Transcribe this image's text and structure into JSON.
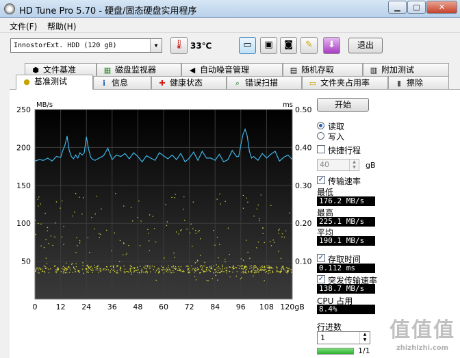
{
  "window": {
    "title": "HD Tune Pro 5.70 - 硬盘/固态硬盘实用程序"
  },
  "menu": [
    {
      "label": "文件(F)"
    },
    {
      "label": "帮助(H)"
    }
  ],
  "toolbar": {
    "drive": "InnostorExt. HDD (120 gB)",
    "temperature": "33℃",
    "exit_label": "退出"
  },
  "tabs_top": [
    {
      "label": "文件基准",
      "icon": "file-benchmark-icon",
      "glyph": "⬢"
    },
    {
      "label": "磁盘监视器",
      "icon": "disk-monitor-icon",
      "glyph": "▦"
    },
    {
      "label": "自动噪音管理",
      "icon": "speaker-icon",
      "glyph": "◀"
    },
    {
      "label": "随机存取",
      "icon": "random-access-icon",
      "glyph": "▤"
    },
    {
      "label": "附加测试",
      "icon": "extra-tests-icon",
      "glyph": "▥"
    }
  ],
  "tabs_bottom": [
    {
      "label": "基准测试",
      "icon": "benchmark-icon",
      "glyph": "●"
    },
    {
      "label": "信息",
      "icon": "info-icon",
      "glyph": "ℹ"
    },
    {
      "label": "健康状态",
      "icon": "health-icon",
      "glyph": "✚"
    },
    {
      "label": "错误扫描",
      "icon": "error-scan-icon",
      "glyph": "⌕"
    },
    {
      "label": "文件夹占用率",
      "icon": "folder-usage-icon",
      "glyph": "▭"
    },
    {
      "label": "擦除",
      "icon": "erase-icon",
      "glyph": "▮"
    }
  ],
  "controls": {
    "start_label": "开始",
    "read_label": "读取",
    "write_label": "写入",
    "short_stroke_label": "快捷行程",
    "short_stroke_value": "40",
    "short_stroke_unit": "gB",
    "transfer_rate_label": "传输速率",
    "min_label": "最低",
    "min_value": "176.2 MB/s",
    "max_label": "最高",
    "max_value": "225.1 MB/s",
    "avg_label": "平均",
    "avg_value": "190.1 MB/s",
    "access_time_label": "存取时间",
    "access_time_value": "0.112 ms",
    "burst_label": "突发传输速率",
    "burst_value": "138.7 MB/s",
    "cpu_label": "CPU 占用",
    "cpu_value": "8.4%",
    "passes_label": "行进数",
    "passes_value": "1",
    "progress_text": "1/1",
    "progress_fraction": 1.0
  },
  "watermark": {
    "main": "值值值",
    "url": "zhizhizhi.com"
  },
  "chart_data": {
    "type": "line",
    "y_left_unit": "MB/s",
    "y_right_unit": "ms",
    "x_ticks": [
      "0",
      "12",
      "24",
      "36",
      "48",
      "60",
      "72",
      "84",
      "96",
      "108",
      "120gB"
    ],
    "y_left_ticks": [
      "250",
      "200",
      "150",
      "100",
      "50"
    ],
    "y_right_ticks": [
      "0.50",
      "0.40",
      "0.30",
      "0.20",
      "0.10"
    ],
    "xlim": [
      0,
      120
    ],
    "ylim_left": [
      0,
      250
    ],
    "ylim_right": [
      0,
      0.5
    ],
    "grid": true,
    "colors": {
      "transfer": "#3fb6e8",
      "access": "#d8d83a",
      "background": "#000000",
      "grid": "#3c3c3c"
    },
    "series": [
      {
        "name": "传输速率",
        "x": [
          0,
          2,
          4,
          6,
          8,
          10,
          12,
          13,
          14,
          15,
          16,
          17,
          18,
          19,
          20,
          21,
          22,
          23,
          24,
          25,
          26,
          27,
          28,
          30,
          32,
          34,
          36,
          38,
          40,
          42,
          44,
          46,
          48,
          50,
          52,
          54,
          56,
          58,
          60,
          62,
          64,
          66,
          68,
          70,
          72,
          74,
          76,
          78,
          80,
          82,
          84,
          86,
          88,
          90,
          92,
          94,
          95,
          96,
          97,
          98,
          99,
          100,
          101,
          102,
          104,
          106,
          108,
          110,
          112,
          114,
          116,
          118,
          120
        ],
        "values": [
          182,
          184,
          183,
          186,
          182,
          188,
          187,
          196,
          203,
          215,
          196,
          188,
          185,
          190,
          186,
          193,
          190,
          193,
          214,
          198,
          187,
          184,
          183,
          186,
          189,
          199,
          184,
          190,
          188,
          192,
          185,
          193,
          188,
          181,
          189,
          186,
          183,
          193,
          189,
          185,
          190,
          184,
          192,
          181,
          186,
          194,
          183,
          195,
          186,
          186,
          183,
          191,
          181,
          184,
          196,
          188,
          188,
          203,
          217,
          224,
          215,
          195,
          186,
          188,
          183,
          192,
          186,
          191,
          195,
          182,
          187,
          190,
          184
        ]
      },
      {
        "name": "存取时间",
        "x_range": [
          0,
          120
        ],
        "y_cluster_ms": [
          0.07,
          0.09
        ],
        "count": 700
      }
    ]
  }
}
